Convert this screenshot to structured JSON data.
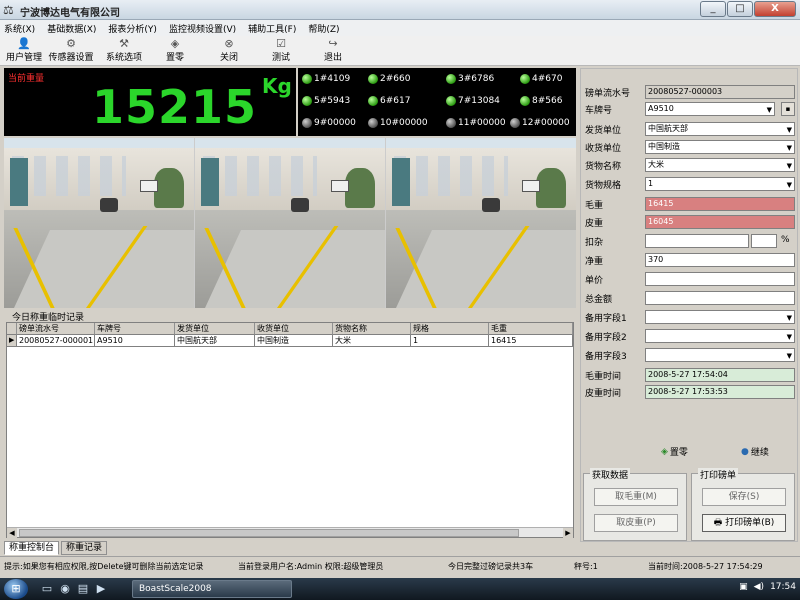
{
  "window": {
    "title": "宁波博达电气有限公司",
    "app_icon": "scale-icon",
    "min_label": "_",
    "max_label": "□",
    "close_label": "X"
  },
  "menu": [
    "系统(X)",
    "基础数据(X)",
    "报表分析(Y)",
    "监控视频设置(V)",
    "辅助工具(F)",
    "帮助(Z)"
  ],
  "toolbar": [
    {
      "label": "用户管理",
      "icon": "user-icon"
    },
    {
      "label": "传感器设置",
      "icon": "sensor-icon"
    },
    {
      "label": "系统选项",
      "icon": "options-icon"
    },
    {
      "label": "置零",
      "icon": "zero-icon"
    },
    {
      "label": "关闭",
      "icon": "close-icon"
    },
    {
      "label": "测试",
      "icon": "test-icon"
    },
    {
      "label": "退出",
      "icon": "exit-icon"
    }
  ],
  "weight": {
    "label": "当前重量",
    "value": "15215",
    "unit": "Kg"
  },
  "channels": [
    {
      "label": "1#4109",
      "on": true
    },
    {
      "label": "2#660",
      "on": true
    },
    {
      "label": "3#6786",
      "on": true
    },
    {
      "label": "4#670",
      "on": true
    },
    {
      "label": "5#5943",
      "on": true
    },
    {
      "label": "6#617",
      "on": true
    },
    {
      "label": "7#13084",
      "on": true
    },
    {
      "label": "8#566",
      "on": true
    },
    {
      "label": "9#00000",
      "on": false
    },
    {
      "label": "10#00000",
      "on": false
    },
    {
      "label": "11#00000",
      "on": false
    },
    {
      "label": "12#00000",
      "on": false
    }
  ],
  "records": {
    "title": "今日称重临时记录",
    "headers": [
      "磅单流水号",
      "车牌号",
      "发货单位",
      "收货单位",
      "货物名称",
      "规格",
      "毛重"
    ],
    "rows": [
      [
        "20080527-000001",
        "A9510",
        "中国航天部",
        "中国制造",
        "大米",
        "1",
        "16415"
      ]
    ]
  },
  "tabs": [
    "称重控制台",
    "称重记录"
  ],
  "form": {
    "fields": [
      {
        "label": "磅单流水号",
        "value": "20080527-000003",
        "style": "gray"
      },
      {
        "label": "车牌号",
        "value": "A9510",
        "style": "select",
        "has_button": true,
        "button_label": "▪"
      },
      {
        "label": "发货单位",
        "value": "中国航天部",
        "style": "select"
      },
      {
        "label": "收货单位",
        "value": "中国制造",
        "style": "select"
      },
      {
        "label": "货物名称",
        "value": "大米",
        "style": "select"
      },
      {
        "label": "货物规格",
        "value": "1",
        "style": "select"
      },
      {
        "label": "毛重",
        "value": "16415",
        "style": "red"
      },
      {
        "label": "皮重",
        "value": "16045",
        "style": "red"
      },
      {
        "label": "扣杂",
        "value": "",
        "style": "pct",
        "suffix": "%"
      },
      {
        "label": "净重",
        "value": "370",
        "style": ""
      },
      {
        "label": "单价",
        "value": "",
        "style": ""
      },
      {
        "label": "总金额",
        "value": "",
        "style": ""
      },
      {
        "label": "备用字段1",
        "value": "",
        "style": "select"
      },
      {
        "label": "备用字段2",
        "value": "",
        "style": "select"
      },
      {
        "label": "备用字段3",
        "value": "",
        "style": "select"
      },
      {
        "label": "毛重时间",
        "value": "2008-5-27  17:54:04",
        "style": "green"
      },
      {
        "label": "皮重时间",
        "value": "2008-5-27  17:53:53",
        "style": "green"
      }
    ],
    "zero_label": "置零",
    "continue_label": "继续",
    "fetch_group": {
      "title": "获取数据",
      "gross_btn": "取毛重(M)",
      "tare_btn": "取皮重(P)"
    },
    "print_group": {
      "title": "打印磅单",
      "save_btn": "保存(S)",
      "print_btn": "打印磅单(B)"
    }
  },
  "status": {
    "hint": "提示:如果您有相应权限,按Delete键可删除当前选定记录",
    "user": "当前登录用户名:Admin  权限:超级管理员",
    "count": "今日完整过磅记录共3车",
    "slot": "秤号:1",
    "time": "当前时间:2008-5-27 17:54:29"
  },
  "taskbar": {
    "task_label": "BoastScale2008",
    "clock": "17:54"
  }
}
